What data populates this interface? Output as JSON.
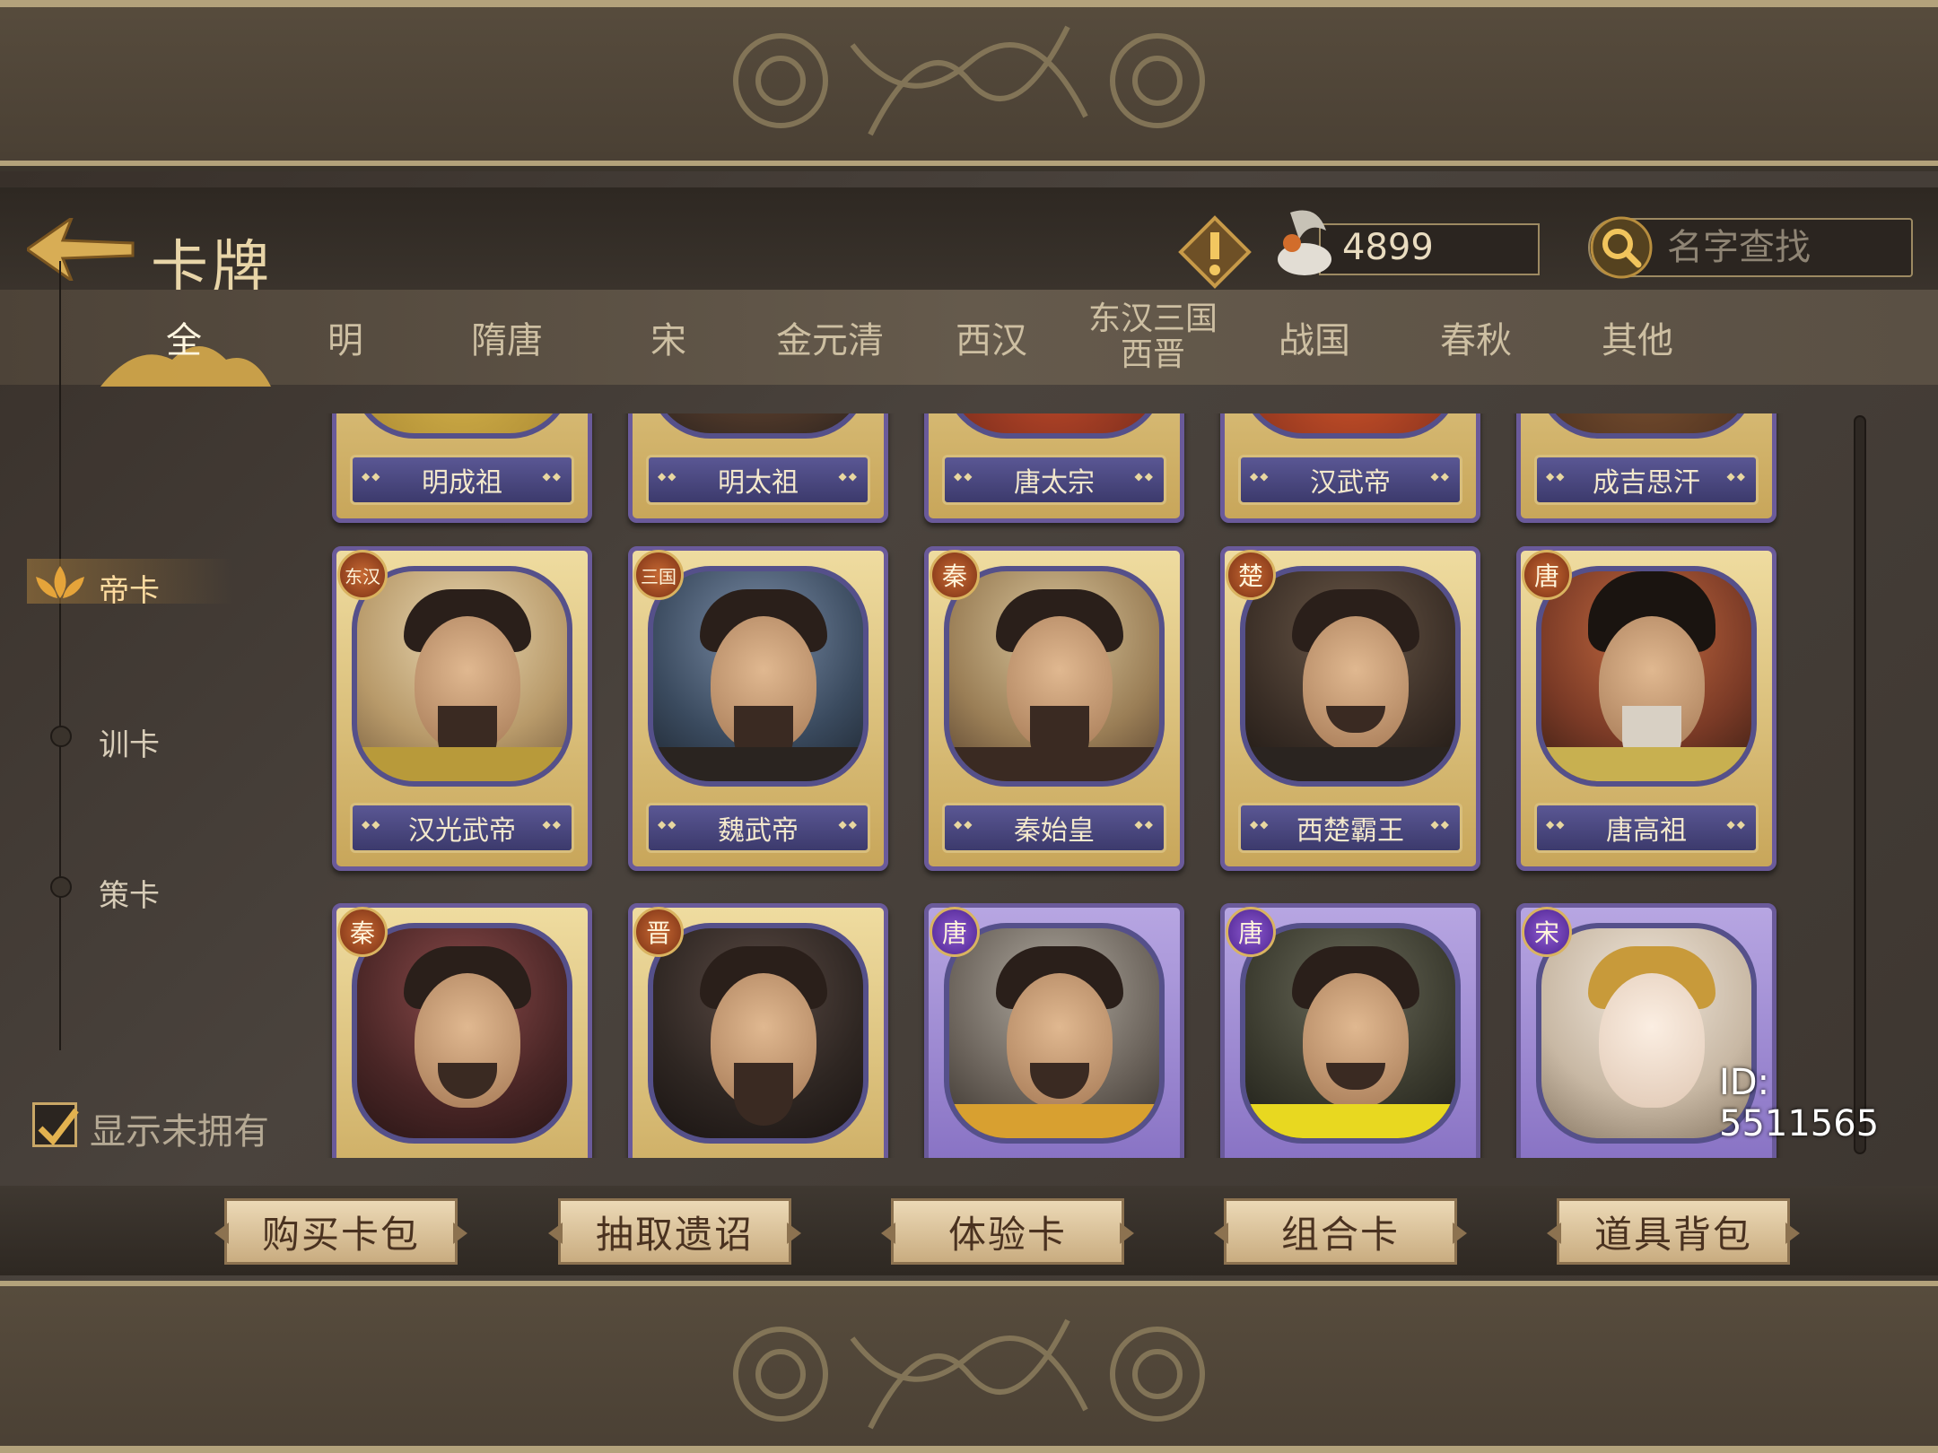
{
  "header": {
    "title": "卡牌",
    "resource_value": "4899",
    "search_placeholder": "名字查找"
  },
  "tabs": [
    "全",
    "明",
    "隋唐",
    "宋",
    "金元清",
    "西汉",
    "东汉三国\n西晋",
    "战国",
    "春秋",
    "其他"
  ],
  "sidebar": {
    "items": [
      "帝卡",
      "训卡",
      "策卡"
    ],
    "active": "帝卡"
  },
  "show_unowned": {
    "label": "显示未拥有",
    "checked": true
  },
  "cards": {
    "row1": [
      {
        "name": "明成祖"
      },
      {
        "name": "明太祖"
      },
      {
        "name": "唐太宗"
      },
      {
        "name": "汉武帝"
      },
      {
        "name": "成吉思汗"
      }
    ],
    "row2": [
      {
        "name": "汉光武帝",
        "badge": "东汉"
      },
      {
        "name": "魏武帝",
        "badge": "三国"
      },
      {
        "name": "秦始皇",
        "badge": "秦"
      },
      {
        "name": "西楚霸王",
        "badge": "楚"
      },
      {
        "name": "唐高祖",
        "badge": "唐"
      }
    ],
    "row3": [
      {
        "badge": "秦"
      },
      {
        "badge": "晋"
      },
      {
        "badge": "唐"
      },
      {
        "badge": "唐"
      },
      {
        "badge": "宋"
      }
    ]
  },
  "actions": [
    "购买卡包",
    "抽取遗诏",
    "体验卡",
    "组合卡",
    "道具背包"
  ],
  "id_label": "ID: 5511565",
  "colors": {
    "gold": "#c9a766",
    "purple_frame": "#6a5a9a",
    "panel": "#3a332c"
  }
}
